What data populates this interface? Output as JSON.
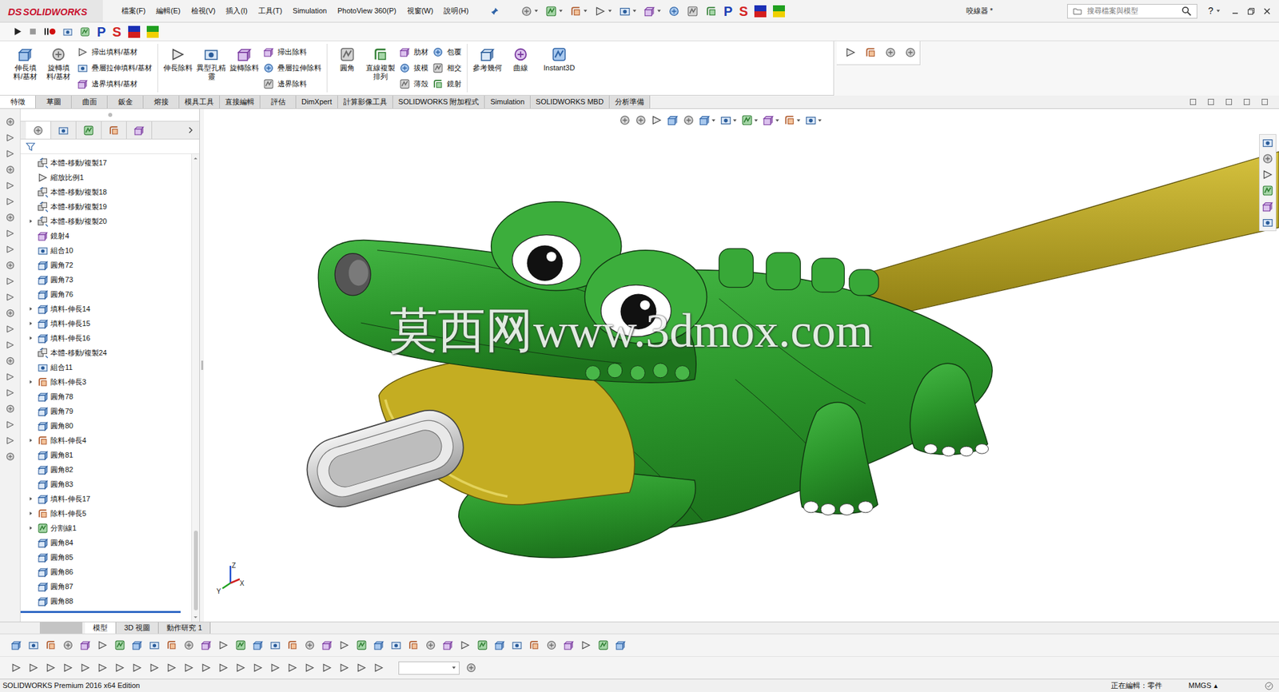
{
  "app": {
    "logo_prefix": "DS",
    "logo": "SOLIDWORKS"
  },
  "menu": [
    "檔案(F)",
    "編輯(E)",
    "檢視(V)",
    "插入(I)",
    "工具(T)",
    "Simulation",
    "PhotoView 360(P)",
    "視窗(W)",
    "說明(H)"
  ],
  "quick_access_letters": [
    {
      "text": "P",
      "color": "#1b3fb5"
    },
    {
      "text": "S",
      "color": "#d42424"
    }
  ],
  "macro_letters": [
    {
      "text": "P",
      "color": "#1b3fb5"
    },
    {
      "text": "S",
      "color": "#d42424"
    }
  ],
  "window": {
    "title": "咬線器 *"
  },
  "search": {
    "placeholder": "搜尋檔案與模型"
  },
  "help": "?",
  "ribbon_groups": [
    [
      {
        "kind": "large",
        "label": "伸長填料/基材"
      },
      {
        "kind": "large",
        "label": "旋轉填料/基材"
      },
      {
        "kind": "stack",
        "labels": [
          "掃出填料/基材",
          "疊層拉伸填料/基材",
          "邊界填料/基材"
        ]
      }
    ],
    [
      {
        "kind": "large",
        "label": "伸長除料"
      },
      {
        "kind": "large",
        "label": "異型孔精靈"
      },
      {
        "kind": "large",
        "label": "旋轉除料"
      },
      {
        "kind": "stack",
        "labels": [
          "掃出除料",
          "疊層拉伸除料",
          "邊界除料"
        ]
      }
    ],
    [
      {
        "kind": "large",
        "label": "圓角"
      },
      {
        "kind": "large",
        "label": "直線複製排列"
      },
      {
        "kind": "stack",
        "labels": [
          "肋材",
          "拔模",
          "薄殼"
        ]
      },
      {
        "kind": "stack",
        "labels": [
          "包覆",
          "相交",
          "鏡射"
        ]
      }
    ],
    [
      {
        "kind": "large",
        "label": "參考幾何"
      },
      {
        "kind": "large",
        "label": "曲線"
      },
      {
        "kind": "large",
        "label": "Instant3D"
      }
    ]
  ],
  "command_tabs": [
    {
      "label": "特徵",
      "selected": true
    },
    {
      "label": "草圖",
      "selected": false
    },
    {
      "label": "曲面",
      "selected": false
    },
    {
      "label": "鈑金",
      "selected": false
    },
    {
      "label": "熔接",
      "selected": false
    },
    {
      "label": "模具工具",
      "selected": false
    },
    {
      "label": "直接編輯",
      "selected": false
    },
    {
      "label": "評估",
      "selected": false
    },
    {
      "label": "DimXpert",
      "selected": false
    },
    {
      "label": "計算影像工具",
      "selected": false
    },
    {
      "label": "SOLIDWORKS 附加程式",
      "selected": false
    },
    {
      "label": "Simulation",
      "selected": false
    },
    {
      "label": "SOLIDWORKS MBD",
      "selected": false
    },
    {
      "label": "分析準備",
      "selected": false
    }
  ],
  "feature_tree": [
    {
      "label": "本體-移動/複製17",
      "kind": "move",
      "expandable": false
    },
    {
      "label": "縮放比例1",
      "kind": "scale",
      "expandable": false
    },
    {
      "label": "本體-移動/複製18",
      "kind": "move",
      "expandable": false
    },
    {
      "label": "本體-移動/複製19",
      "kind": "move",
      "expandable": false
    },
    {
      "label": "本體-移動/複製20",
      "kind": "move",
      "expandable": true
    },
    {
      "label": "鏡射4",
      "kind": "mirror",
      "expandable": false
    },
    {
      "label": "組合10",
      "kind": "combine",
      "expandable": false
    },
    {
      "label": "圓角72",
      "kind": "fillet",
      "expandable": false
    },
    {
      "label": "圓角73",
      "kind": "fillet",
      "expandable": false
    },
    {
      "label": "圓角76",
      "kind": "fillet",
      "expandable": false
    },
    {
      "label": "填料-伸長14",
      "kind": "extrude",
      "expandable": true
    },
    {
      "label": "填料-伸長15",
      "kind": "extrude",
      "expandable": true
    },
    {
      "label": "填料-伸長16",
      "kind": "extrude",
      "expandable": true
    },
    {
      "label": "本體-移動/複製24",
      "kind": "move",
      "expandable": false
    },
    {
      "label": "組合11",
      "kind": "combine",
      "expandable": false
    },
    {
      "label": "除料-伸長3",
      "kind": "cut",
      "expandable": true
    },
    {
      "label": "圓角78",
      "kind": "fillet",
      "expandable": false
    },
    {
      "label": "圓角79",
      "kind": "fillet",
      "expandable": false
    },
    {
      "label": "圓角80",
      "kind": "fillet",
      "expandable": false
    },
    {
      "label": "除料-伸長4",
      "kind": "cut",
      "expandable": true
    },
    {
      "label": "圓角81",
      "kind": "fillet",
      "expandable": false
    },
    {
      "label": "圓角82",
      "kind": "fillet",
      "expandable": false
    },
    {
      "label": "圓角83",
      "kind": "fillet",
      "expandable": false
    },
    {
      "label": "填料-伸長17",
      "kind": "extrude",
      "expandable": true
    },
    {
      "label": "除料-伸長5",
      "kind": "cut",
      "expandable": true
    },
    {
      "label": "分割線1",
      "kind": "split",
      "expandable": true
    },
    {
      "label": "圓角84",
      "kind": "fillet",
      "expandable": false
    },
    {
      "label": "圓角85",
      "kind": "fillet",
      "expandable": false
    },
    {
      "label": "圓角86",
      "kind": "fillet",
      "expandable": false
    },
    {
      "label": "圓角87",
      "kind": "fillet",
      "expandable": false
    },
    {
      "label": "圓角88",
      "kind": "fillet",
      "expandable": false
    }
  ],
  "viewport": {
    "watermark": "莫西网www.3dmox.com",
    "triad": [
      "Z",
      "X",
      "Y"
    ]
  },
  "bottom_tabs": [
    {
      "label": "模型",
      "selected": true
    },
    {
      "label": "3D 視圖",
      "selected": false
    },
    {
      "label": "動作研究 1",
      "selected": false
    }
  ],
  "status_bar": {
    "edition": "SOLIDWORKS Premium 2016 x64 Edition",
    "editing": "正在編輯：零件",
    "units": "MMGS",
    "units_arrow": "▴"
  }
}
